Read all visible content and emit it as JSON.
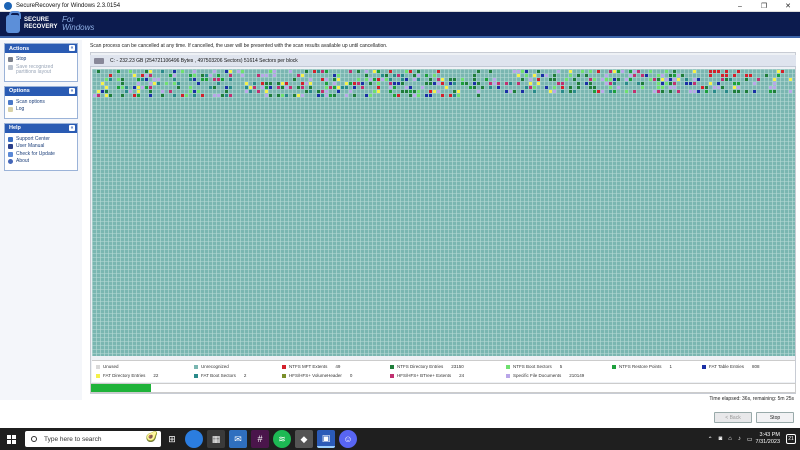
{
  "window": {
    "title": "SecureRecovery for Windows 2.3.0154",
    "minimize": "–",
    "maximize": "❐",
    "close": "✕"
  },
  "header": {
    "brand_line1": "SECURE",
    "brand_line2": "RECOVERY",
    "brand_for": "For",
    "brand_windows": "Windows"
  },
  "sidebar": {
    "actions": {
      "title": "Actions",
      "items": [
        {
          "label": "Stop"
        },
        {
          "label": "Save recognized partitions layout"
        }
      ]
    },
    "options": {
      "title": "Options",
      "items": [
        {
          "label": "Scan options"
        },
        {
          "label": "Log"
        }
      ]
    },
    "help": {
      "title": "Help",
      "items": [
        {
          "label": "Support Center"
        },
        {
          "label": "User Manual"
        },
        {
          "label": "Check for Update"
        },
        {
          "label": "About"
        }
      ]
    }
  },
  "main": {
    "notice": "Scan process can be cancelled at any time. If cancelled, the user will be presented with the scan results available  up until cancellation.",
    "disk": "C: - 232.23 GB (254721106496 Bytes , 497503206 Sectors) 51614 Sectors per block",
    "progress": 0.085,
    "elapsed": "Time elapsed: 36s, remaining: 5m 25s"
  },
  "legend": [
    {
      "label": "Unused",
      "count": "",
      "color": "#d9d9d9"
    },
    {
      "label": "Unrecognized",
      "count": "",
      "color": "#7ab6b1"
    },
    {
      "label": "NTFS MFT Extents",
      "count": "49",
      "color": "#d3202b"
    },
    {
      "label": "NTFS Directory Entries",
      "count": "23150",
      "color": "#1f7d3a"
    },
    {
      "label": "NTFS Boot Sectors",
      "count": "5",
      "color": "#6fe06f"
    },
    {
      "label": "NTFS Restore Points",
      "count": "1",
      "color": "#1da03c"
    },
    {
      "label": "FAT Table Entries",
      "count": "808",
      "color": "#1a2fa5"
    },
    {
      "label": "FAT Directory Entries",
      "count": "22",
      "color": "#f4f04a"
    },
    {
      "label": "FAT Boot Sectors",
      "count": "2",
      "color": "#2a8a8a"
    },
    {
      "label": "HFS/HFS+ VolumeHeader",
      "count": "0",
      "color": "#7a8f2a"
    },
    {
      "label": "HFS/HFS+ BTree+ Extents",
      "count": "24",
      "color": "#c03070"
    },
    {
      "label": "Specific File Documents",
      "count": "210149",
      "color": "#b9a6e8"
    }
  ],
  "buttons": {
    "back": "< Back",
    "stop": "Stop"
  },
  "taskbar": {
    "search_placeholder": "Type here to search",
    "time": "3:43 PM",
    "date": "7/31/2023",
    "notifications": "21",
    "icons": [
      "task-view-icon",
      "chrome-icon",
      "photos-icon",
      "mail-icon",
      "slack-icon",
      "spotify-icon",
      "app-icon",
      "securerecovery-icon",
      "discord-icon"
    ]
  },
  "colors": {
    "header_bg": "#0c1b4e",
    "panel_head": "#2a5bb3",
    "grid_cell": "#7ab6b1",
    "progress": "#1fb33a"
  }
}
